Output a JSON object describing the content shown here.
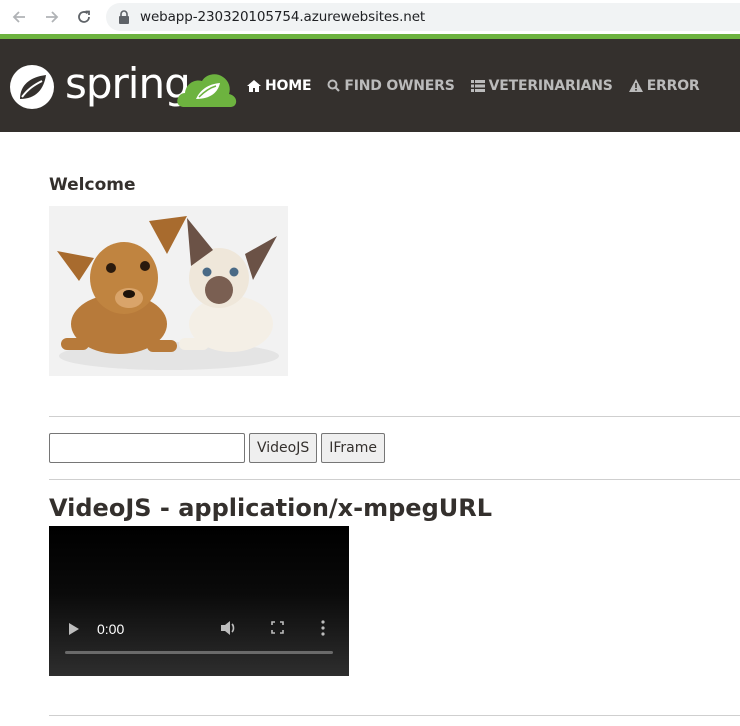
{
  "browser": {
    "url": "webapp-230320105754.azurewebsites.net",
    "icons": [
      "back-icon",
      "forward-icon",
      "reload-icon",
      "lock-icon"
    ]
  },
  "navbar": {
    "brand": "spring",
    "items": [
      {
        "label": "HOME",
        "icon": "home-icon",
        "active": true
      },
      {
        "label": "FIND OWNERS",
        "icon": "search-icon",
        "active": false
      },
      {
        "label": "VETERINARIANS",
        "icon": "list-icon",
        "active": false
      },
      {
        "label": "ERROR",
        "icon": "warning-icon",
        "active": false
      }
    ],
    "colors": {
      "background": "#34302d",
      "accent": "#6db33f"
    }
  },
  "main": {
    "heading": "Welcome",
    "image_name": "pets-image",
    "input": {
      "value": "",
      "placeholder": ""
    },
    "buttons": {
      "videojs": "VideoJS",
      "iframe": "IFrame"
    },
    "video_title": "VideoJS - application/x-mpegURL",
    "video": {
      "time": "0:00"
    }
  }
}
